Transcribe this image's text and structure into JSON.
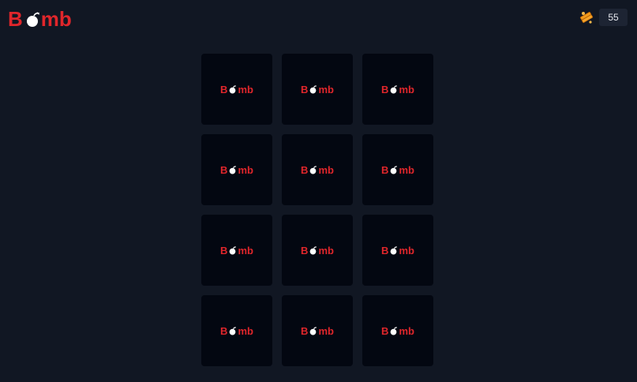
{
  "header": {
    "logo_prefix": "B",
    "logo_suffix": "mb",
    "logo_icon": "bomb-icon"
  },
  "currency": {
    "icon": "coin-stack-icon",
    "amount": "55"
  },
  "colors": {
    "background": "#111723",
    "tile": "#030711",
    "brand_red": "#e0262b",
    "coin_orange": "#f29a1a"
  },
  "tiles": [
    {
      "prefix": "B",
      "suffix": "mb"
    },
    {
      "prefix": "B",
      "suffix": "mb"
    },
    {
      "prefix": "B",
      "suffix": "mb"
    },
    {
      "prefix": "B",
      "suffix": "mb"
    },
    {
      "prefix": "B",
      "suffix": "mb"
    },
    {
      "prefix": "B",
      "suffix": "mb"
    },
    {
      "prefix": "B",
      "suffix": "mb"
    },
    {
      "prefix": "B",
      "suffix": "mb"
    },
    {
      "prefix": "B",
      "suffix": "mb"
    },
    {
      "prefix": "B",
      "suffix": "mb"
    },
    {
      "prefix": "B",
      "suffix": "mb"
    },
    {
      "prefix": "B",
      "suffix": "mb"
    }
  ]
}
